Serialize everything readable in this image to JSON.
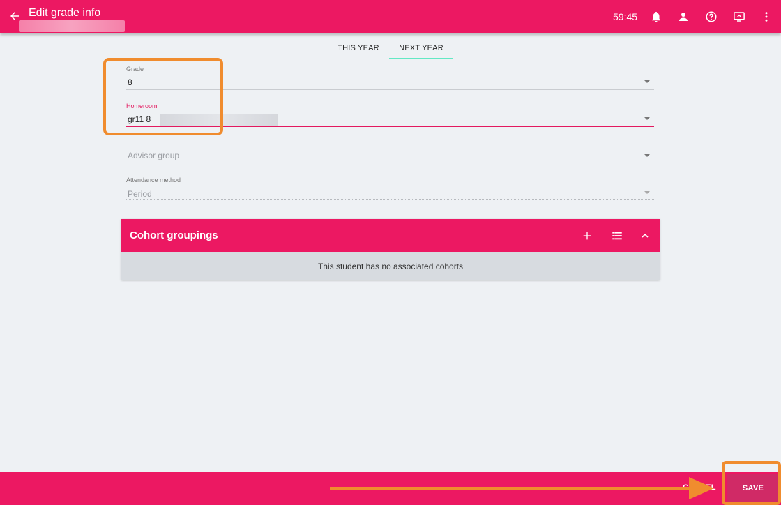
{
  "header": {
    "title": "Edit grade info",
    "timer": "59:45",
    "icons": [
      "back-arrow-icon",
      "bell-icon",
      "person-icon",
      "help-icon",
      "monitor-icon",
      "more-vert-icon"
    ]
  },
  "tabs": [
    {
      "label": "THIS YEAR",
      "active": false
    },
    {
      "label": "NEXT YEAR",
      "active": true
    }
  ],
  "form": {
    "grade": {
      "label": "Grade",
      "value": "8"
    },
    "homeroom": {
      "label": "Homeroom",
      "value": "gr11  8"
    },
    "advisor": {
      "placeholder": "Advisor group"
    },
    "attendance": {
      "label": "Attendance method",
      "value": "Period"
    }
  },
  "cohorts": {
    "title": "Cohort groupings",
    "empty_message": "This student has no associated cohorts"
  },
  "footer": {
    "cancel_label": "CANCEL",
    "save_label": "SAVE"
  },
  "colors": {
    "brand": "#ec1862",
    "tab_indicator": "#64e8c4",
    "highlight": "#f08c2e",
    "background": "#eef1f4"
  }
}
